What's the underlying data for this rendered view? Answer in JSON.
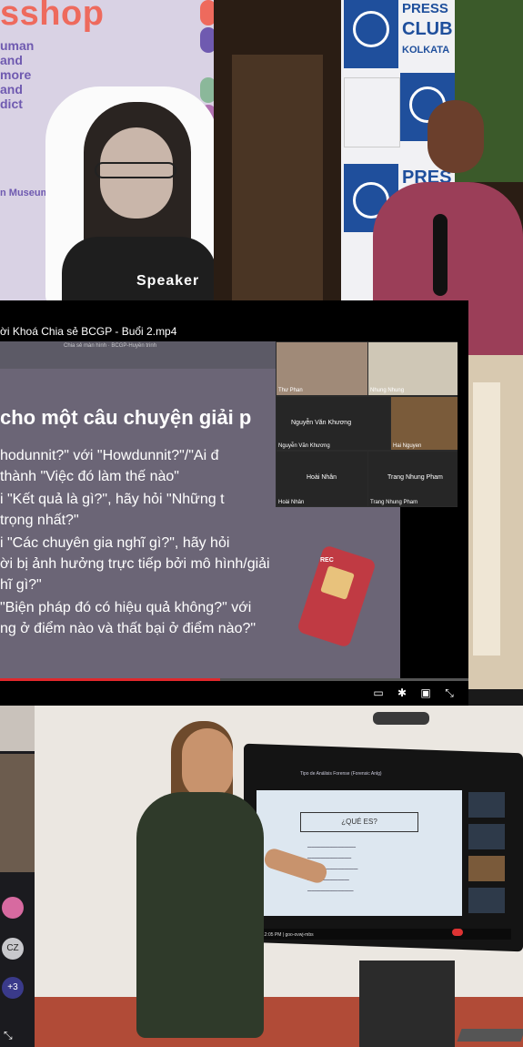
{
  "poster": {
    "title": "sshop",
    "lines": [
      "uman",
      "and",
      "more",
      "and",
      "dict"
    ],
    "museum": "n Museum",
    "speaker": "Speaker"
  },
  "press": {
    "top_text": [
      "PRESS",
      "CLUB",
      "KOLKATA"
    ],
    "lower_text": "PRES"
  },
  "video": {
    "title": "ời Khoá Chia sẻ BCGP - Buổi 2.mp4",
    "inner_title": "Chia sẻ màn hình · BCGP-Huyền trinh",
    "slide_heading": "cho một câu chuyện giải p",
    "slide_lines": [
      "hodunnit?\" với \"Howdunnit?\"/\"Ai đ",
      "thành \"Việc đó làm thế nào\"",
      "i \"Kết quả là gì?\", hãy hỏi \"Những t",
      "trọng nhất?\"",
      "i \"Các chuyên gia nghĩ gì?\", hãy hỏi",
      "ời bị ảnh hưởng trực tiếp bởi mô hình/giải",
      "hĩ gì?\"",
      "\"Biện pháp đó có hiệu quả không?\" với",
      "ng ở điểm nào và thất bại ở điểm nào?\""
    ],
    "recorder_label": "REC",
    "progress": 0.47,
    "participants": [
      {
        "name": "Thư Phan"
      },
      {
        "name": "Nhung Nhung"
      },
      {
        "name": "Nguyễn Văn Khương",
        "center": "Nguyễn Văn Khương"
      },
      {
        "name": "Hai Nguyen"
      },
      {
        "name": "Hoài Nhân",
        "center": "Hoài Nhân"
      },
      {
        "name": "Trang Nhung Pham",
        "center": "Trang Nhung Pham"
      }
    ]
  },
  "phone": {
    "initials": "CZ",
    "count": "+3"
  },
  "room": {
    "screen_heading": "¿QUÉ ES?",
    "screen_title": "Tipo de Análisis Forense (Forensic Anlg)",
    "screen_time": "12:05 PM | goo-ovwj-mbs"
  }
}
